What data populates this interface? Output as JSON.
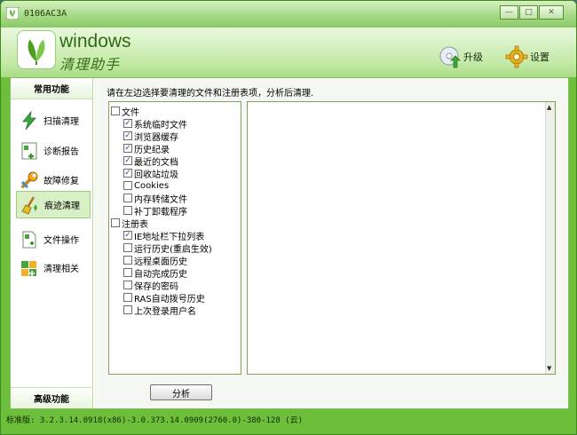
{
  "window": {
    "title": "0106AC3A",
    "min_glyph": "—",
    "max_glyph": "□",
    "close_glyph": "✕"
  },
  "brand": {
    "name_en": "windows",
    "name_cn": "清理助手"
  },
  "toolbar": {
    "upgrade_label": "升级",
    "settings_label": "设置"
  },
  "sidebar": {
    "header": "常用功能",
    "footer": "高级功能",
    "items": [
      {
        "label": "扫描清理",
        "icon": "lightning-icon"
      },
      {
        "label": "诊断报告",
        "icon": "report-icon"
      },
      {
        "label": "故障修复",
        "icon": "wrench-icon"
      },
      {
        "label": "痕迹清理",
        "icon": "broom-icon",
        "active": true
      },
      {
        "label": "文件操作",
        "icon": "file-icon"
      },
      {
        "label": "清理相关",
        "icon": "puzzle-icon"
      }
    ]
  },
  "content": {
    "hint": "请在左边选择要清理的文件和注册表项，分析后清理.",
    "tree": [
      {
        "label": "文件",
        "checked": false,
        "level": 0
      },
      {
        "label": "系统临时文件",
        "checked": true,
        "level": 1
      },
      {
        "label": "浏览器缓存",
        "checked": true,
        "level": 1
      },
      {
        "label": "历史纪录",
        "checked": true,
        "level": 1
      },
      {
        "label": "最近的文档",
        "checked": true,
        "level": 1
      },
      {
        "label": "回收站垃圾",
        "checked": true,
        "level": 1
      },
      {
        "label": "Cookies",
        "checked": false,
        "level": 1
      },
      {
        "label": "内存转储文件",
        "checked": false,
        "level": 1
      },
      {
        "label": "补丁卸载程序",
        "checked": false,
        "level": 1
      },
      {
        "label": "注册表",
        "checked": false,
        "level": 0
      },
      {
        "label": "IE地址栏下拉列表",
        "checked": true,
        "level": 1
      },
      {
        "label": "运行历史(重启生效)",
        "checked": false,
        "level": 1
      },
      {
        "label": "远程桌面历史",
        "checked": false,
        "level": 1
      },
      {
        "label": "自动完成历史",
        "checked": false,
        "level": 1
      },
      {
        "label": "保存的密码",
        "checked": false,
        "level": 1
      },
      {
        "label": "RAS自动拨号历史",
        "checked": false,
        "level": 1
      },
      {
        "label": "上次登录用户名",
        "checked": false,
        "level": 1
      }
    ],
    "analyze_label": "分析"
  },
  "status": {
    "text": "标准版: 3.2.3.14.0918(x86)-3.0.373.14.0909(2760.0)-380-128 (云)"
  },
  "colors": {
    "frame": "#6dbe3a",
    "active_item": "#d9f0c6",
    "accent": "#2f6b13"
  }
}
